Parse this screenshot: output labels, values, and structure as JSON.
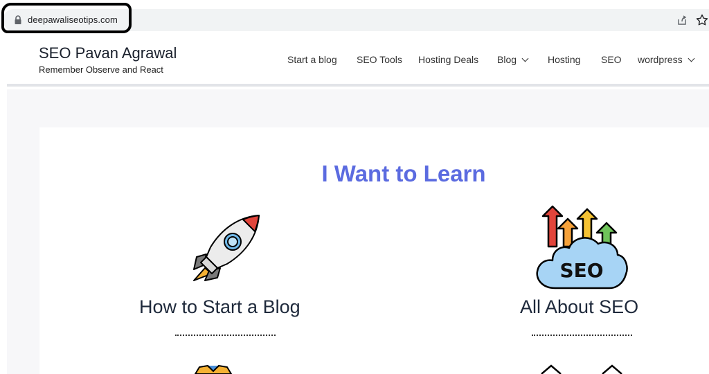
{
  "browser": {
    "url": "deepawaliseotips.com",
    "icons": [
      "lock-icon",
      "share-icon",
      "star-icon"
    ]
  },
  "site": {
    "title": "SEO Pavan Agrawal",
    "tagline": "Remember Observe and React"
  },
  "nav": {
    "items": [
      {
        "label": "Start a blog",
        "dropdown": false
      },
      {
        "label": "SEO Tools",
        "dropdown": false
      },
      {
        "label": "Hosting Deals",
        "dropdown": false
      },
      {
        "label": "Blog",
        "dropdown": true
      },
      {
        "label": "Hosting",
        "dropdown": false
      },
      {
        "label": "SEO",
        "dropdown": false
      },
      {
        "label": "wordpress",
        "dropdown": true
      }
    ]
  },
  "main": {
    "heading": "I Want to Learn",
    "cards": [
      {
        "title": "How to Start a Blog",
        "icon": "rocket-icon"
      },
      {
        "title": "All About SEO",
        "icon": "seo-cloud-icon"
      }
    ],
    "cards_partial": [
      {
        "icon": "shirt-icon"
      },
      {
        "icon": "mountain-icon"
      }
    ]
  },
  "colors": {
    "heading": "#5b6be0",
    "text_dark": "#1e293b",
    "page_bg": "#f7f7f9"
  }
}
